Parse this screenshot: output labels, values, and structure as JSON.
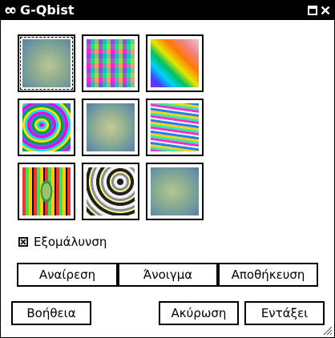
{
  "window": {
    "title": "G-Qbist",
    "icon": "gimp-eye-icon",
    "controls": [
      "maximize-icon",
      "close-icon"
    ]
  },
  "variations": [
    {
      "name": "thumb-center",
      "selected": true,
      "pattern": "soft-gradient"
    },
    {
      "name": "thumb-1",
      "selected": false,
      "pattern": "checker-psychedelic"
    },
    {
      "name": "thumb-2",
      "selected": false,
      "pattern": "diagonal-rainbow"
    },
    {
      "name": "thumb-3",
      "selected": false,
      "pattern": "swirl-rainbow"
    },
    {
      "name": "thumb-4",
      "selected": false,
      "pattern": "soft-gradient"
    },
    {
      "name": "thumb-5",
      "selected": false,
      "pattern": "wave-bands"
    },
    {
      "name": "thumb-6",
      "selected": false,
      "pattern": "concentric-ellipses"
    },
    {
      "name": "thumb-7",
      "selected": false,
      "pattern": "gray-swirl"
    },
    {
      "name": "thumb-8",
      "selected": false,
      "pattern": "soft-gradient"
    }
  ],
  "antialias": {
    "label": "Εξομάλυνση",
    "checked": true
  },
  "actions": {
    "undo": "Αναίρεση",
    "open": "Άνοιγμα",
    "save": "Αποθήκευση"
  },
  "dialog": {
    "help": "Βοήθεια",
    "cancel": "Ακύρωση",
    "ok": "Εντάξει"
  }
}
